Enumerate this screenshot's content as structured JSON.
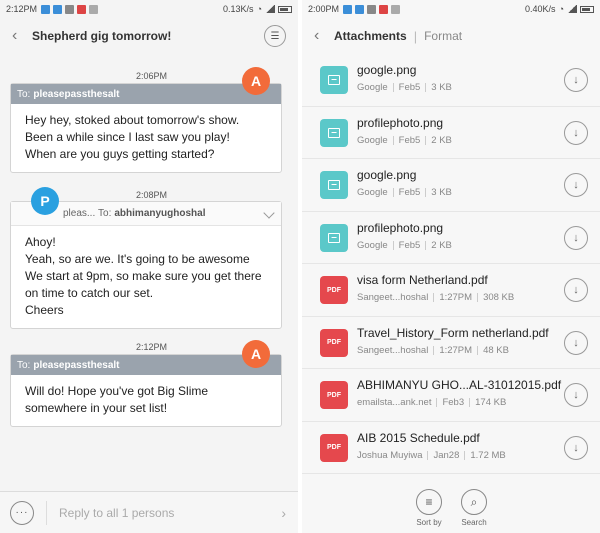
{
  "left": {
    "status": {
      "time": "2:12PM",
      "speed": "0.13K/s"
    },
    "header": {
      "title": "Shepherd gig tomorrow!",
      "back_icon": "arrow-left-icon",
      "menu_icon": "list-icon"
    },
    "messages": [
      {
        "timestamp": "2:06PM",
        "avatar": "A",
        "avatar_color": "#f26b3a",
        "to_prefix": "To:",
        "to": "pleasepassthesalt",
        "body": "Hey hey, stoked about tomorrow's show. Been a while since I last saw you play!\nWhen are you guys getting started?"
      },
      {
        "timestamp": "2:08PM",
        "avatar": "P",
        "avatar_color": "#2aa0e0",
        "from": "pleas...",
        "to_prefix": "To:",
        "to": "abhimanyughoshal",
        "body": "Ahoy!\nYeah, so are we. It's going to be awesome\nWe start at 9pm, so make sure you get there on time to catch our set.\nCheers"
      },
      {
        "timestamp": "2:12PM",
        "avatar": "A",
        "avatar_color": "#f26b3a",
        "to_prefix": "To:",
        "to": "pleasepassthesalt",
        "body": "Will do! Hope you've got Big Slime somewhere in your set list!"
      }
    ],
    "reply": {
      "more_label": "···",
      "placeholder": "Reply to all 1 persons"
    }
  },
  "right": {
    "status": {
      "time": "2:00PM",
      "speed": "0.40K/s"
    },
    "header": {
      "title": "Attachments",
      "subtitle": "Format"
    },
    "files": [
      {
        "type": "image",
        "name": "google.png",
        "sender": "Google",
        "date": "Feb5",
        "size": "3 KB"
      },
      {
        "type": "image",
        "name": "profilephoto.png",
        "sender": "Google",
        "date": "Feb5",
        "size": "2 KB"
      },
      {
        "type": "image",
        "name": "google.png",
        "sender": "Google",
        "date": "Feb5",
        "size": "3 KB"
      },
      {
        "type": "image",
        "name": "profilephoto.png",
        "sender": "Google",
        "date": "Feb5",
        "size": "2 KB"
      },
      {
        "type": "pdf",
        "name": "visa form Netherland.pdf",
        "sender": "Sangeet...hoshal",
        "date": "1:27PM",
        "size": "308 KB"
      },
      {
        "type": "pdf",
        "name": "Travel_History_Form netherland.pdf",
        "sender": "Sangeet...hoshal",
        "date": "1:27PM",
        "size": "48 KB"
      },
      {
        "type": "pdf",
        "name": "ABHIMANYU GHO...AL-31012015.pdf",
        "sender": "emailsta...ank.net",
        "date": "Feb3",
        "size": "174 KB"
      },
      {
        "type": "pdf",
        "name": "AIB 2015 Schedule.pdf",
        "sender": "Joshua Muyiwa",
        "date": "Jan28",
        "size": "1.72 MB"
      }
    ],
    "pdf_badge": "PDF",
    "tools": {
      "sort_label": "Sort by",
      "search_label": "Search"
    }
  }
}
